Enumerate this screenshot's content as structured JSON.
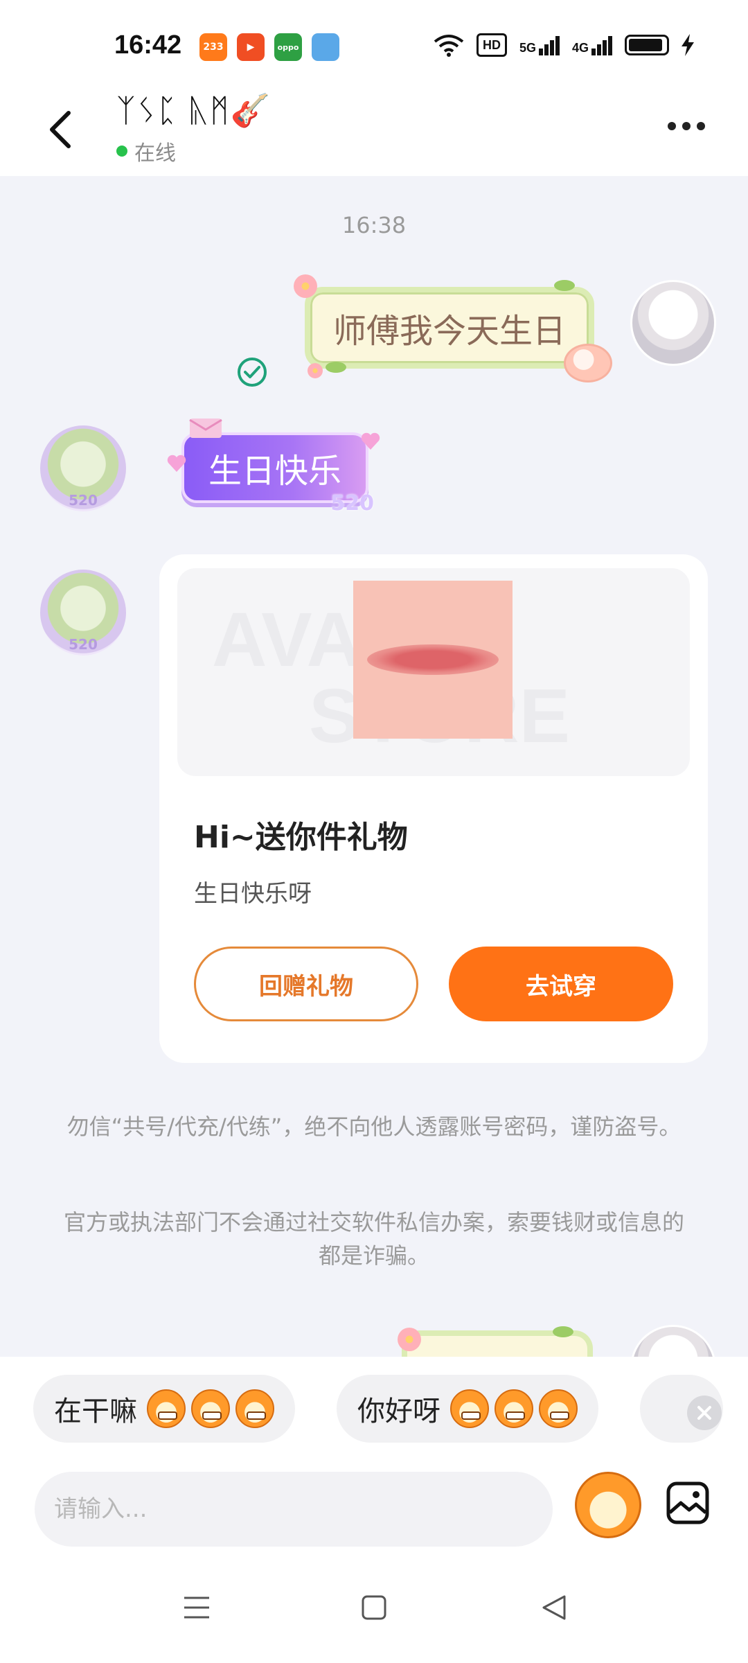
{
  "status_bar": {
    "time": "16:42",
    "apps": [
      {
        "name": "233-app-icon",
        "label": "233",
        "color": "#ff7a1a"
      },
      {
        "name": "video-app-icon",
        "label": "▶",
        "color": "#f04e23"
      },
      {
        "name": "oppo-app-icon",
        "label": "oppo",
        "color": "#2ea043"
      },
      {
        "name": "game-app-icon",
        "label": "",
        "color": "#5aa8e8"
      }
    ],
    "hd_label": "HD",
    "signal_5g": "5G",
    "signal_4g": "4G"
  },
  "header": {
    "contact_name": "ᛉᛊᛈ ᚣᛗ🎸",
    "presence": "在线"
  },
  "chat": {
    "timestamp": "16:38",
    "my_message": "师傅我今天生日",
    "sticker_text": "生日快乐",
    "sticker_number": "520",
    "avatar_badge": "520",
    "gift_card": {
      "watermark_top": "AVATAR",
      "watermark_bottom": "STORE",
      "title": "Hi~送你件礼物",
      "subtitle": "生日快乐呀",
      "return_button": "回赠礼物",
      "try_button": "去试穿"
    },
    "notice_1": "勿信“共号/代充/代练”，绝不向他人透露账号密码，谨防盗号。",
    "notice_2": "官方或执法部门不会通过社交软件私信办案，索要钱财或信息的都是诈骗。"
  },
  "quick_replies": [
    {
      "text": "在干嘛"
    },
    {
      "text": "你好呀"
    }
  ],
  "input": {
    "placeholder": "请输入..."
  },
  "colors": {
    "accent_orange": "#ff7215",
    "online_green": "#27c24c",
    "read_green": "#1fa27a",
    "chat_background": "#f2f3f9"
  }
}
